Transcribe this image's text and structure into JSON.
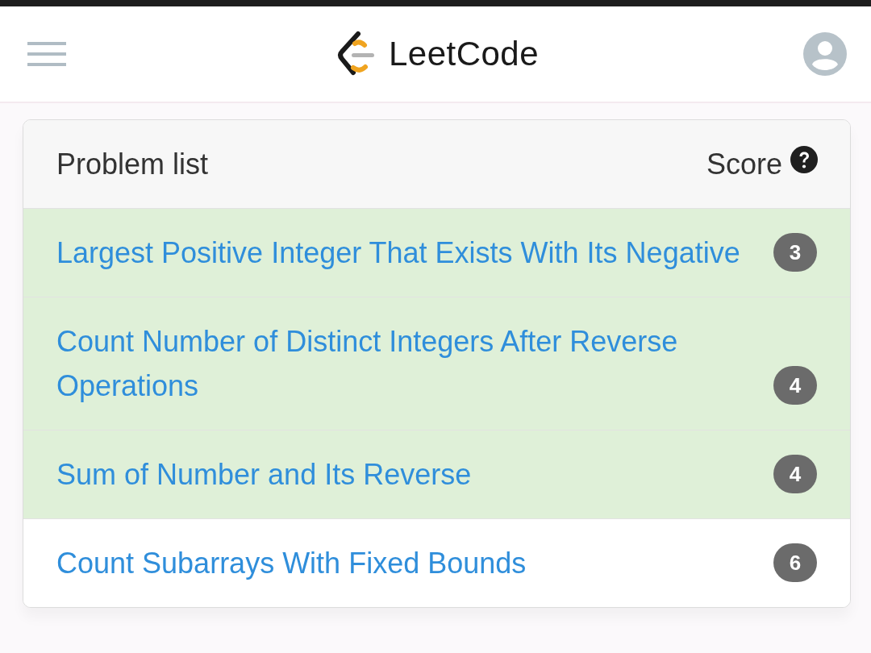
{
  "header": {
    "logo_text": "LeetCode"
  },
  "problem_list": {
    "title": "Problem list",
    "score_label": "Score",
    "problems": [
      {
        "title": "Largest Positive Integer That Exists With Its Negative",
        "score": "3",
        "solved": true
      },
      {
        "title": "Count Number of Distinct Integers After Reverse Operations",
        "score": "4",
        "solved": true
      },
      {
        "title": "Sum of Number and Its Reverse",
        "score": "4",
        "solved": true
      },
      {
        "title": "Count Subarrays With Fixed Bounds",
        "score": "6",
        "solved": false
      }
    ]
  }
}
